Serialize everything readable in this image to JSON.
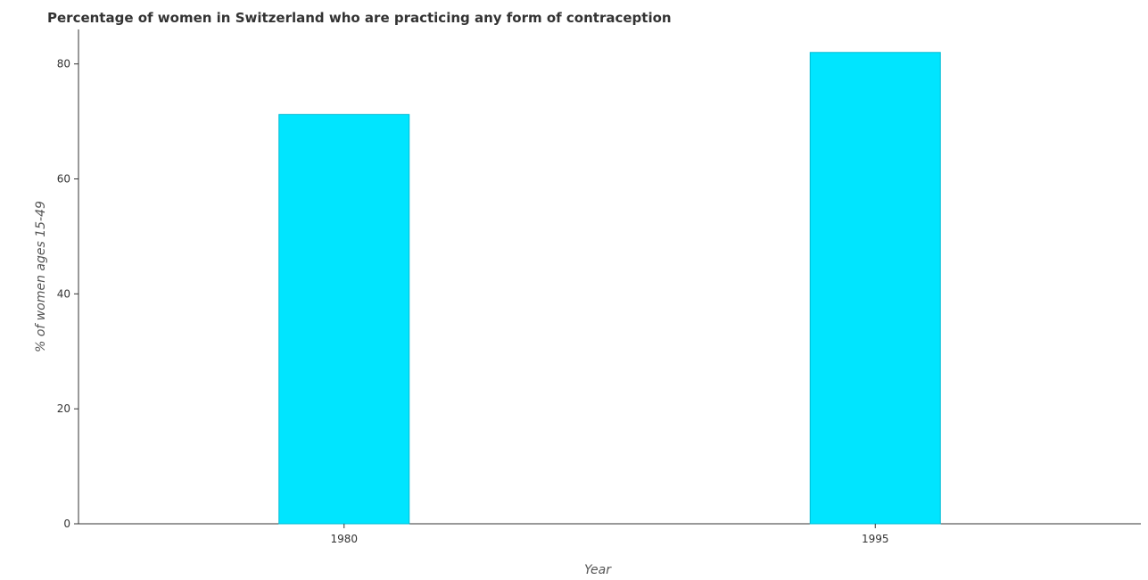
{
  "chart_data": {
    "type": "bar",
    "title": "Percentage of women in Switzerland who are practicing any form of contraception",
    "xlabel": "Year",
    "ylabel": "% of women ages 15-49",
    "categories": [
      "1980",
      "1995"
    ],
    "values": [
      71.2,
      82.0
    ],
    "ylim": [
      0,
      86
    ],
    "yticks": [
      0,
      20,
      40,
      60,
      80
    ],
    "grid": false,
    "legend": "none",
    "bar_color": "#00e5ff",
    "bar_edge_color": "#00bcd4"
  }
}
